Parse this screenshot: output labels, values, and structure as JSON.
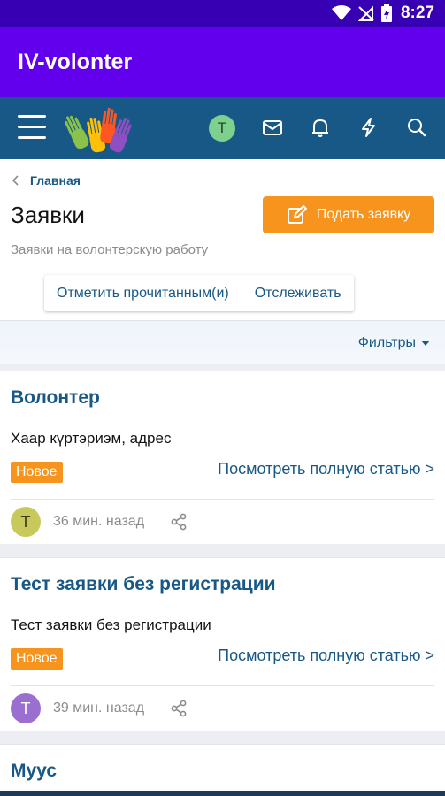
{
  "status_bar": {
    "time": "8:27"
  },
  "app_bar": {
    "title": "IV-volonter"
  },
  "nav": {
    "user_initial": "T"
  },
  "breadcrumb": {
    "label": "Главная"
  },
  "page": {
    "title": "Заявки",
    "description": "Заявки на волонтерскую работу",
    "submit_label": "Подать заявку",
    "mark_read_label": "Отметить прочитанным(и)",
    "watch_label": "Отслеживать",
    "filters_label": "Фильтры"
  },
  "items": [
    {
      "title": "Волонтер",
      "body": "Хаар күртэриэм, адрес",
      "badge": "Новое",
      "read_more": "Посмотреть полную статью >",
      "avatar_initial": "T",
      "avatar_color": "#c9c85a",
      "time": "36 мин. назад"
    },
    {
      "title": "Тест заявки без регистрации",
      "body": "Тест заявки без регистрации",
      "badge": "Новое",
      "read_more": "Посмотреть полную статью >",
      "avatar_initial": "T",
      "avatar_color": "#9b6fd1",
      "time": "39 мин. назад"
    },
    {
      "title": "Муус"
    }
  ],
  "colors": {
    "status_bar": "#3700b3",
    "app_bar": "#6200ee",
    "site_nav": "#185886",
    "accent": "#f7941d",
    "link": "#185886"
  }
}
